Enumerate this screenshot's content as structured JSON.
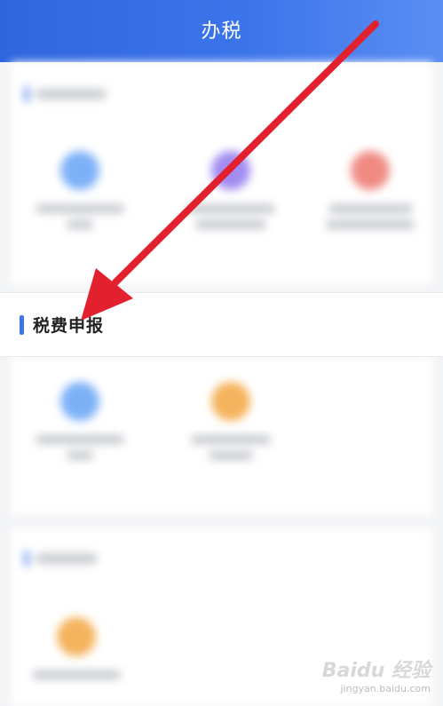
{
  "header": {
    "title": "办税"
  },
  "section_focus": {
    "title": "税费申报"
  },
  "colors": {
    "header_start": "#2f66e0",
    "header_end": "#5a8ef3",
    "accent_bar": "#3d74ea",
    "arrow": "#e3202d"
  },
  "watermark": {
    "logo": "Baidu 经验",
    "sub": "jingyan.baidu.com"
  }
}
